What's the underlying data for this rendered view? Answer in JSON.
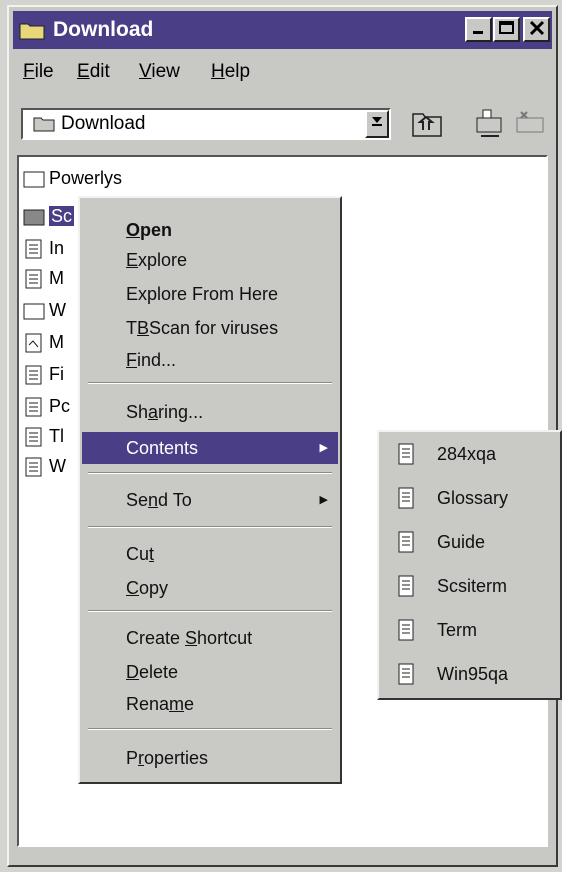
{
  "window": {
    "title": "Download"
  },
  "menubar": {
    "items": [
      {
        "label": "File",
        "mnemonic": "F",
        "rest": "ile"
      },
      {
        "label": "Edit",
        "mnemonic": "E",
        "rest": "dit"
      },
      {
        "label": "View",
        "mnemonic": "V",
        "rest": "iew"
      },
      {
        "label": "Help",
        "mnemonic": "H",
        "rest": "elp"
      }
    ]
  },
  "toolbar": {
    "address_value": "Download"
  },
  "files": [
    {
      "name": "Powerlys",
      "icon": "folder-icon"
    },
    {
      "name": "Sc",
      "icon": "folder-icon",
      "selected": true
    },
    {
      "name": "In",
      "icon": "document-icon"
    },
    {
      "name": "M",
      "icon": "document-icon"
    },
    {
      "name": "W",
      "icon": "folder-icon"
    },
    {
      "name": "M",
      "icon": "document-icon"
    },
    {
      "name": "Fi",
      "icon": "document-icon"
    },
    {
      "name": "Pc",
      "icon": "document-icon"
    },
    {
      "name": "Tl",
      "icon": "document-icon"
    },
    {
      "name": "W",
      "icon": "document-icon"
    }
  ],
  "context_menu": {
    "open": {
      "mn": "O",
      "rest": "pen"
    },
    "explore": {
      "mn": "E",
      "rest": "xplore"
    },
    "explore_from_here": "Explore From Here",
    "tbscan": {
      "pre": "T",
      "mn": "B",
      "rest": "Scan for viruses"
    },
    "find": {
      "mn": "F",
      "rest": "ind..."
    },
    "sharing": {
      "pre": "Sh",
      "mn": "a",
      "rest": "ring..."
    },
    "contents": "Contents",
    "send_to": {
      "pre": "Se",
      "mn": "n",
      "rest": "d To"
    },
    "cut": {
      "pre": "Cu",
      "mn": "t",
      "rest": ""
    },
    "copy": {
      "mn": "C",
      "rest": "opy"
    },
    "create_shortcut": {
      "pre": "Create ",
      "mn": "S",
      "rest": "hortcut"
    },
    "delete": {
      "mn": "D",
      "rest": "elete"
    },
    "rename": {
      "pre": "Rena",
      "mn": "m",
      "rest": "e"
    },
    "properties": {
      "pre": "P",
      "mn": "r",
      "rest": "operties"
    }
  },
  "submenu": {
    "items": [
      "284xqa",
      "Glossary",
      "Guide",
      "Scsiterm",
      "Term",
      "Win95qa"
    ]
  },
  "colors": {
    "title_bar": "#4a3f86",
    "highlight": "#4a3f86",
    "face": "#c8c8c4"
  }
}
